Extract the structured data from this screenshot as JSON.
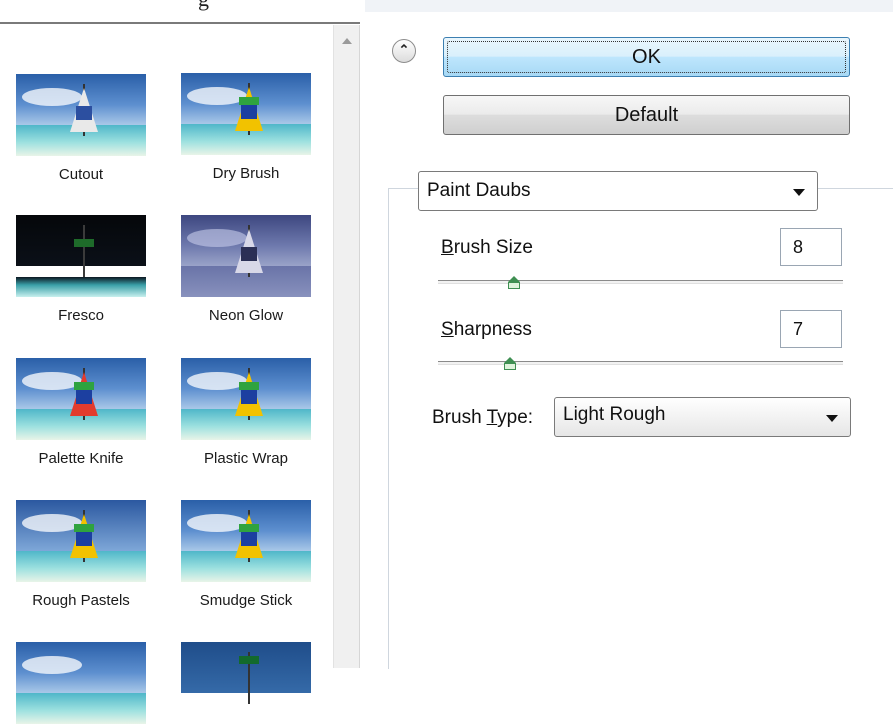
{
  "window": {
    "title_fragment": "g"
  },
  "thumbnails": [
    {
      "label": "Cutout"
    },
    {
      "label": "Dry Brush"
    },
    {
      "label": "Fresco"
    },
    {
      "label": "Neon Glow"
    },
    {
      "label": "Palette Knife"
    },
    {
      "label": "Plastic Wrap"
    },
    {
      "label": "Rough Pastels"
    },
    {
      "label": "Smudge Stick"
    }
  ],
  "buttons": {
    "ok": "OK",
    "default": "Default"
  },
  "filter": {
    "selected": "Paint Daubs"
  },
  "params": {
    "brush_size": {
      "label_pre": "",
      "label_mn": "B",
      "label_post": "rush Size",
      "value": "8",
      "fraction": 0.19
    },
    "sharpness": {
      "label_pre": "",
      "label_mn": "S",
      "label_post": "harpness",
      "value": "7",
      "fraction": 0.18
    },
    "brush_type": {
      "label_pre": "Brush ",
      "label_mn": "T",
      "label_post": "ype:",
      "selected": "Light Rough"
    }
  },
  "colors": {
    "ok_border": "#3c7fb1",
    "slider_thumb": "#3f8f52"
  }
}
